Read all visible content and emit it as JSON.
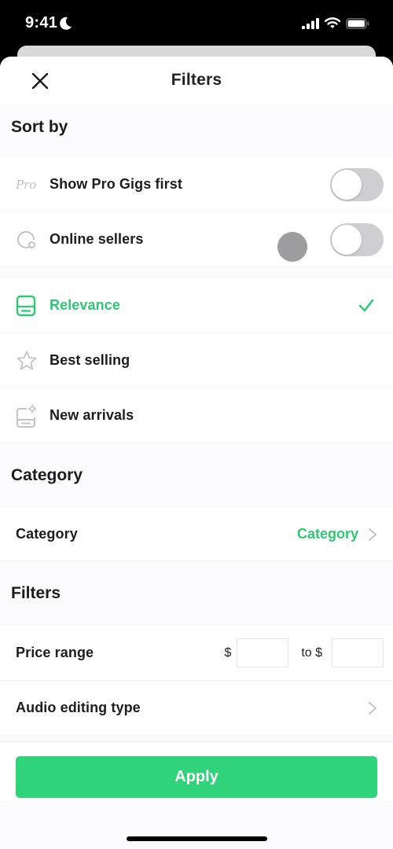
{
  "status_bar": {
    "time": "9:41",
    "icons": [
      "moon-icon",
      "cellular-signal-icon",
      "wifi-icon",
      "battery-icon"
    ]
  },
  "header": {
    "title": "Filters",
    "close_icon": "close-icon"
  },
  "sort_by": {
    "title": "Sort by",
    "toggles": [
      {
        "label": "Show Pro Gigs first",
        "icon": "pro-badge-icon",
        "icon_text": "Pro",
        "on": false
      },
      {
        "label": "Online sellers",
        "icon": "online-status-icon",
        "on": false
      }
    ],
    "options": [
      {
        "label": "Relevance",
        "icon": "relevance-icon",
        "selected": true
      },
      {
        "label": "Best selling",
        "icon": "star-icon",
        "selected": false
      },
      {
        "label": "New arrivals",
        "icon": "new-arrivals-icon",
        "selected": false
      }
    ]
  },
  "category": {
    "title": "Category",
    "row_label": "Category",
    "row_value": "Category"
  },
  "filters": {
    "title": "Filters",
    "price_range": {
      "label": "Price range",
      "min_prefix": "$",
      "max_prefix": "to $",
      "min_value": "",
      "max_value": ""
    },
    "audio_editing_type": {
      "label": "Audio editing type"
    }
  },
  "footer": {
    "apply_label": "Apply"
  },
  "colors": {
    "accent": "#2fc975",
    "apply_button": "#2fd37a",
    "toggle_off": "#cfcfd3",
    "background": "#fbfafd"
  }
}
